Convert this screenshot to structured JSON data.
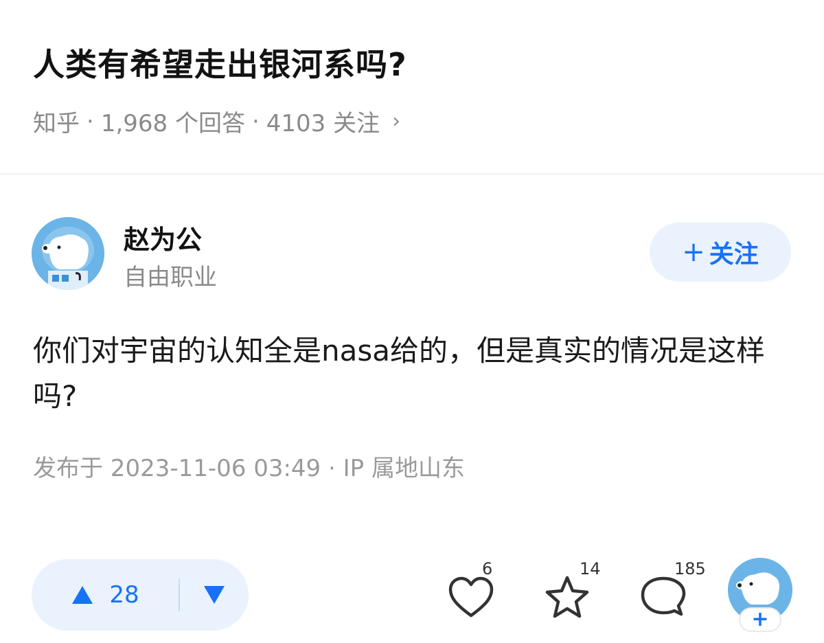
{
  "question": {
    "title": "人类有希望走出银河系吗?",
    "source": "知乎",
    "answers": "1,968 个回答",
    "followers": "4103 关注",
    "chevron": "›"
  },
  "author": {
    "name": "赵为公",
    "bio": "自由职业",
    "avatar_icon": "polar-bear-astronaut-avatar"
  },
  "follow_button": {
    "plus": "+",
    "label": "关注"
  },
  "answer": {
    "text": "你们对宇宙的认知全是nasa给的，但是真实的情况是这样吗?",
    "published": "发布于 2023-11-06 03:49 · IP 属地山东"
  },
  "actions": {
    "upvotes": "28",
    "likes": "6",
    "favorites": "14",
    "comments": "185",
    "add_plus": "+"
  },
  "colors": {
    "accent": "#1772f6",
    "accent_bg": "#eaf2fd",
    "meta": "#8a8a8a"
  }
}
